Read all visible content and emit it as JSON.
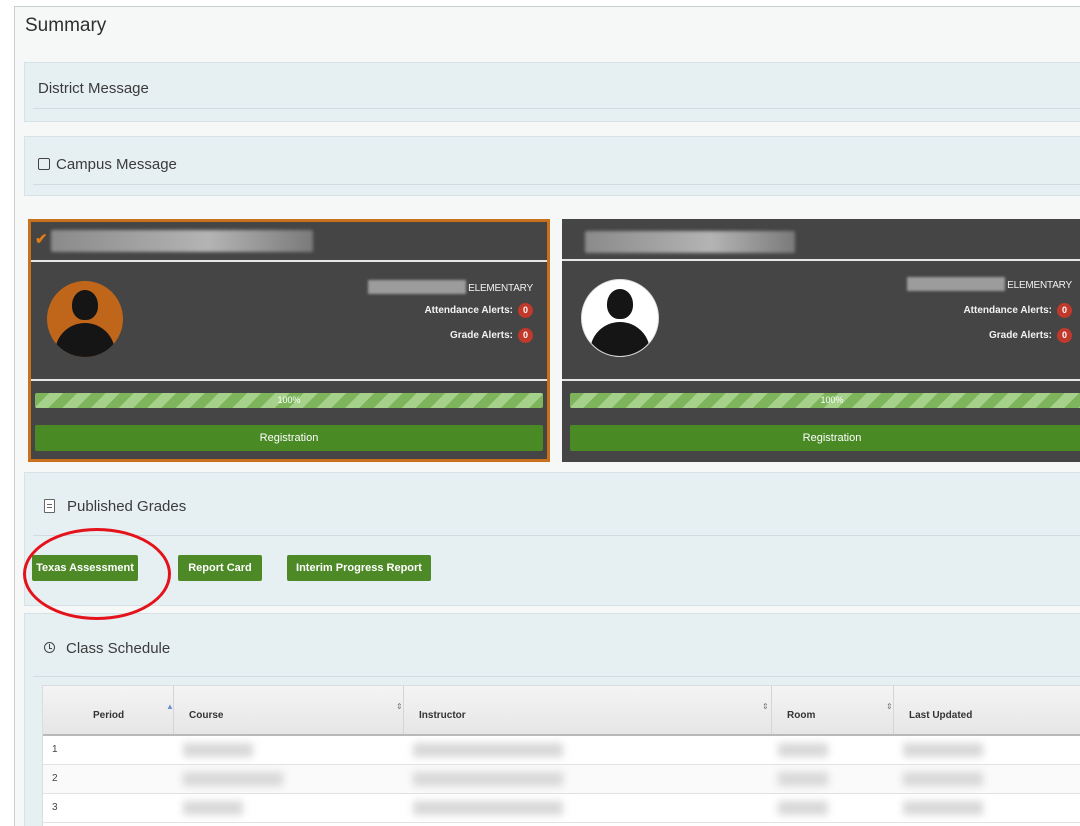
{
  "page_title": "Summary",
  "district_message": {
    "title": "District Message"
  },
  "campus_message": {
    "title": "Campus Message"
  },
  "students": [
    {
      "selected": true,
      "school_suffix": "ELEMENTARY",
      "attendance_label": "Attendance Alerts:",
      "attendance_count": "0",
      "grade_label": "Grade Alerts:",
      "grade_count": "0",
      "progress": "100%",
      "registration_label": "Registration"
    },
    {
      "selected": false,
      "school_suffix": "ELEMENTARY",
      "attendance_label": "Attendance Alerts:",
      "attendance_count": "0",
      "grade_label": "Grade Alerts:",
      "grade_count": "0",
      "progress": "100%",
      "registration_label": "Registration"
    }
  ],
  "published_grades": {
    "title": "Published Grades",
    "buttons": [
      "Texas Assessment",
      "Report Card",
      "Interim Progress Report"
    ]
  },
  "class_schedule": {
    "title": "Class Schedule",
    "columns": [
      "Period",
      "Course",
      "Instructor",
      "Room",
      "Last Updated"
    ],
    "rows": [
      "1",
      "2",
      "3"
    ]
  },
  "colors": {
    "accent_green": "#4d8a27",
    "selected_border": "#c8701b",
    "alert_red": "#c0392b",
    "annotation_red": "#e4121a"
  }
}
